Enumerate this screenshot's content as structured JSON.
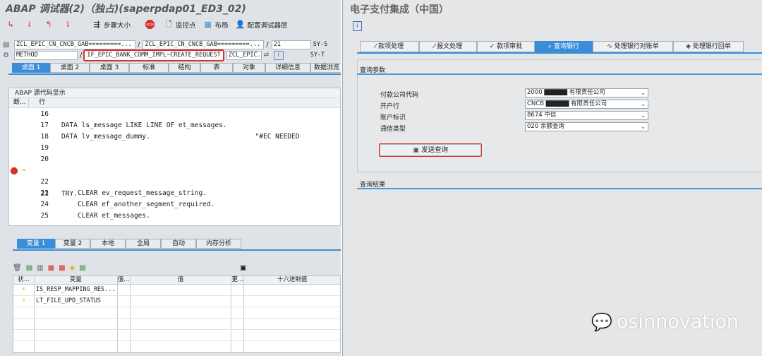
{
  "left_window": {
    "title": "ABAP 调试器(2)（独占)(saperpdap01_ED3_02)",
    "toolbar": [
      {
        "label": "",
        "icon": "step-into-icon"
      },
      {
        "label": "",
        "icon": "step-over-icon"
      },
      {
        "label": "",
        "icon": "return-icon"
      },
      {
        "label": "",
        "icon": "continue-icon"
      },
      {
        "label": "步骤大小",
        "icon": "step-size-icon"
      },
      {
        "label": "",
        "icon": "stop-icon"
      },
      {
        "label": "监控点",
        "icon": "watchpoint-icon"
      },
      {
        "label": "布局",
        "icon": "layout-icon"
      },
      {
        "label": "配置调试器层",
        "icon": "config-layer-icon"
      }
    ],
    "row1": {
      "field1": "ZCL_EPIC_CN_CNCB_GAB=========...",
      "sep1": "/",
      "field2": "ZCL_EPIC_CN_CNCB_GAB=========...",
      "sep2": "/",
      "line": "21",
      "sy": "SY-S"
    },
    "row2": {
      "type": "METHOD",
      "sep": "/",
      "method": "IF_EPIC_BANK_COMM_IMPL~CREATE_REQUEST",
      "class": "ZCL_EPIC...",
      "sy": "SY-T"
    },
    "desktop_tabs": [
      "桌面 1",
      "桌面 2",
      "桌面 3",
      "标准",
      "结构",
      "表",
      "对象",
      "详细信息",
      "数据浏览"
    ],
    "source": {
      "header": "ABAP 源代码显示",
      "col_bp": "断...",
      "col_line": "行",
      "lines": [
        {
          "no": "16",
          "text": ""
        },
        {
          "no": "17",
          "text": "DATA ls_message LIKE LINE OF et_messages."
        },
        {
          "no": "18",
          "text": "DATA lv_message_dummy.                          \"#EC NEEDED"
        },
        {
          "no": "19",
          "text": ""
        },
        {
          "no": "20",
          "text": ""
        },
        {
          "no": "21",
          "text": "TRY."
        },
        {
          "no": "22",
          "text": ""
        },
        {
          "no": "23",
          "text": "    CLEAR ev_request_message_string."
        },
        {
          "no": "24",
          "text": "    CLEAR ef_another_segment_required."
        },
        {
          "no": "25",
          "text": "    CLEAR et_messages."
        }
      ]
    },
    "var_tabs": [
      "变量 1",
      "变量 2",
      "本地",
      "全局",
      "自动",
      "内存分析"
    ],
    "var_table": {
      "headers": [
        "状...",
        "变量",
        "值...",
        "值",
        "更...",
        "十六进制值"
      ],
      "rows": [
        {
          "name": "IS_RESP_MAPPING_RES..."
        },
        {
          "name": "LT_FILE_UPD_STATUS"
        }
      ]
    }
  },
  "right_window": {
    "title": "电子支付集成（中国）",
    "tabs": [
      {
        "label": "款项处理",
        "icon": "wand-icon"
      },
      {
        "label": "报文处理",
        "icon": "wand-icon"
      },
      {
        "label": "款项审批",
        "icon": "check-icon"
      },
      {
        "label": "查询银行",
        "icon": "search-icon"
      },
      {
        "label": "处理银行对账单",
        "icon": "statement-icon"
      },
      {
        "label": "处理银行回单",
        "icon": "receipt-icon"
      }
    ],
    "query_params": {
      "section_title": "查询参数",
      "fields": [
        {
          "label": "付款公司代码",
          "value": "2000 ▇▇▇▇▇ 有限责任公司"
        },
        {
          "label": "开户行",
          "value": "CNCB ▇▇▇▇▇ 有限责任公司"
        },
        {
          "label": "账户标识",
          "value": "8674  中信"
        },
        {
          "label": "通信类型",
          "value": "020  余额查询"
        }
      ],
      "send_button": "发送查询"
    },
    "results": {
      "section_title": "查询结果"
    }
  },
  "watermark": {
    "text": "osinnovation"
  },
  "colors": {
    "accent": "#3a8dd8",
    "highlight": "#d9302b"
  }
}
